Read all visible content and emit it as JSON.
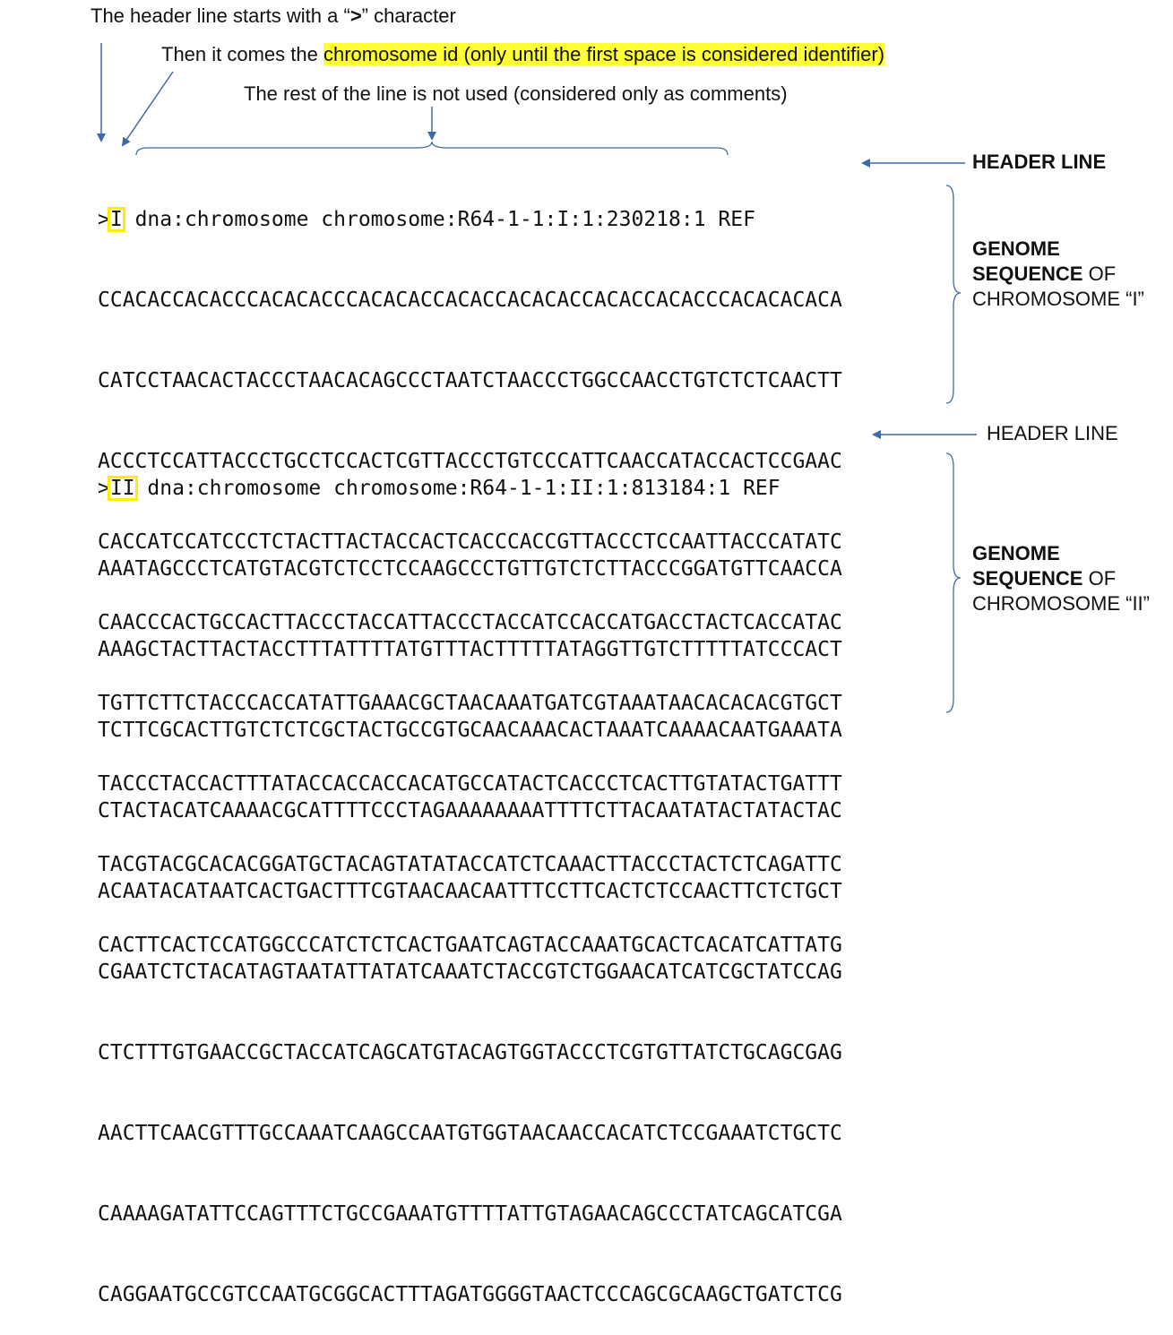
{
  "annotations": {
    "line1": "The header line starts with a “",
    "line1_symbol": ">",
    "line1_end": "” character",
    "line2_prefix": "Then it comes the ",
    "line2_highlight": "chromosome id (only until the first space is considered identifier)",
    "line3": "The rest of the line is not used (considered only as comments)"
  },
  "blocks": [
    {
      "prompt": ">",
      "id": "I",
      "header_rest": " dna:chromosome chromosome:R64-1-1:I:1:230218:1 REF",
      "lines": [
        "CCACACCACACCCACACACCCACACACCACACCACACACCACACCACACCCACACACACA",
        "CATCCTAACACTACCCTAACACAGCCCTAATCTAACCCTGGCCAACCTGTCTCTCAACTT",
        "ACCCTCCATTACCCTGCCTCCACTCGTTACCCTGTCCCATTCAACCATACCACTCCGAAC",
        "CACCATCCATCCCTCTACTTACTACCACTCACCCACCGTTACCCTCCAATTACCCATATC",
        "CAACCCACTGCCACTTACCCTACCATTACCCTACCATCCACCATGACCTACTCACCATAC",
        "TGTTCTTCTACCCACCATATTGAAACGCTAACAAATGATCGTAAATAACACACACGTGCT",
        "TACCCTACCACTTTATACCACCACCACATGCCATACTCACCCTCACTTGTATACTGATTT",
        "TACGTACGCACACGGATGCTACAGTATATACCATCTCAAACTTACCCTACTCTCAGATTC",
        "CACTTCACTCCATGGCCCATCTCTCACTGAATCAGTACCAAATGCACTCACATCATTATG"
      ]
    },
    {
      "prompt": ">",
      "id": "II",
      "header_rest": " dna:chromosome chromosome:R64-1-1:II:1:813184:1 REF",
      "lines": [
        "AAATAGCCCTCATGTACGTCTCCTCCAAGCCCTGTTGTCTCTTACCCGGATGTTCAACCA",
        "AAAGCTACTTACTACCTTTATTTTATGTTTACTTTTTATAGGTTGTCTTTTTATCCCACT",
        "TCTTCGCACTTGTCTCTCGCTACTGCCGTGCAACAAACACTAAATCAAAACAATGAAATA",
        "CTACTACATCAAAACGCATTTTCCCTAGAAAAAAAATTTTCTTACAATATACTATACTAC",
        "ACAATACATAATCACTGACTTTCGTAACAACAATTTCCTTCACTCTCCAACTTCTCTGCT",
        "CGAATCTCTACATAGTAATATTATATCAAATCTACCGTCTGGAACATCATCGCTATCCAG",
        "CTCTTTGTGAACCGCTACCATCAGCATGTACAGTGGTACCCTCGTGTTATCTGCAGCGAG",
        "AACTTCAACGTTTGCCAAATCAAGCCAATGTGGTAACAACCACATCTCCGAAATCTGCTC",
        "CAAAAGATATTCCAGTTTCTGCCGAAATGTTTTATTGTAGAACAGCCCTATCAGCATCGA",
        "CAGGAATGCCGTCCAATGCGGCACTTTAGATGGGGTAACTCCCAGCGCAAGCTGATCTCG"
      ]
    }
  ],
  "labels": {
    "header1": "HEADER LINE",
    "header2": "HEADER LINE",
    "genome1": {
      "bold1": "GENOME",
      "bold2": "SEQUENCE",
      "of": " OF",
      "chrom": "CHROMOSOME “I”"
    },
    "genome2": {
      "bold1": "GENOME",
      "bold2": "SEQUENCE",
      "of": " OF",
      "chrom": "CHROMOSOME “II”"
    }
  },
  "colors": {
    "arrow": "#3f6aa8",
    "highlight": "#ffff33",
    "id_box": "#ffee00"
  }
}
